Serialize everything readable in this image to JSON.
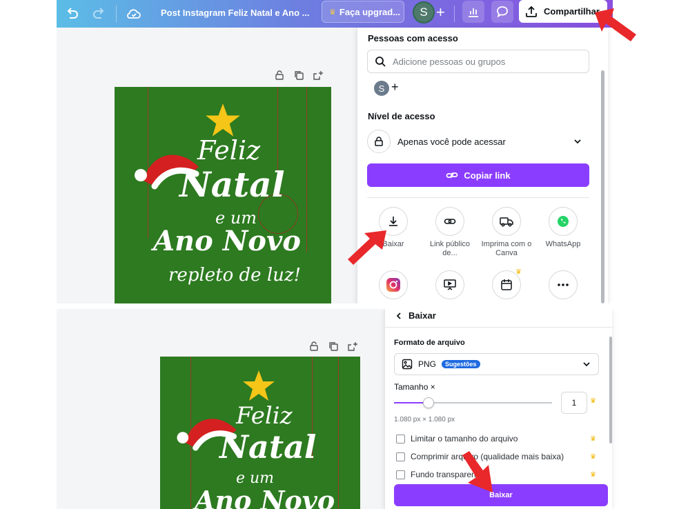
{
  "topbar": {
    "title": "Post Instagram Feliz Natal e Ano ...",
    "upgrade_label": "Faça upgrad...",
    "avatar_initial": "S",
    "share_label": "Compartilhar"
  },
  "design": {
    "line1": "Feliz",
    "line2": "Natal",
    "line3": "e um",
    "line4": "Ano Novo",
    "line5": "repleto de luz!"
  },
  "share_panel": {
    "title": "Pessoas com acesso",
    "search_placeholder": "Adicione pessoas ou grupos",
    "avatar_initial": "S",
    "access_title": "Nível de acesso",
    "access_value": "Apenas você pode acessar",
    "copy_link_label": "Copiar link",
    "options": [
      {
        "label": "Baixar",
        "icon": "download-icon"
      },
      {
        "label": "Link público de...",
        "icon": "link-icon"
      },
      {
        "label": "Imprima com o Canva",
        "icon": "truck-icon"
      },
      {
        "label": "WhatsApp",
        "icon": "whatsapp-icon"
      }
    ],
    "options_row2": [
      "instagram-icon",
      "present-icon",
      "calendar-icon",
      "more-icon"
    ]
  },
  "download_panel": {
    "back_label": "Baixar",
    "format_title": "Formato de arquivo",
    "format_value": "PNG",
    "format_badge": "Sugestões",
    "size_title": "Tamanho ×",
    "size_value": "1",
    "size_fraction": 0.22,
    "dimensions": "1.080 px × 1.080 px",
    "checks": [
      {
        "label": "Limitar o tamanho do arquivo"
      },
      {
        "label": "Comprimir arquivo (qualidade mais baixa)"
      },
      {
        "label": "Fundo transparente"
      }
    ],
    "download_label": "Baixar"
  },
  "colors": {
    "accent": "#8b3dff",
    "design_green": "#2d7a20",
    "arrow_red": "#e8282b",
    "crown": "#f2b705"
  }
}
